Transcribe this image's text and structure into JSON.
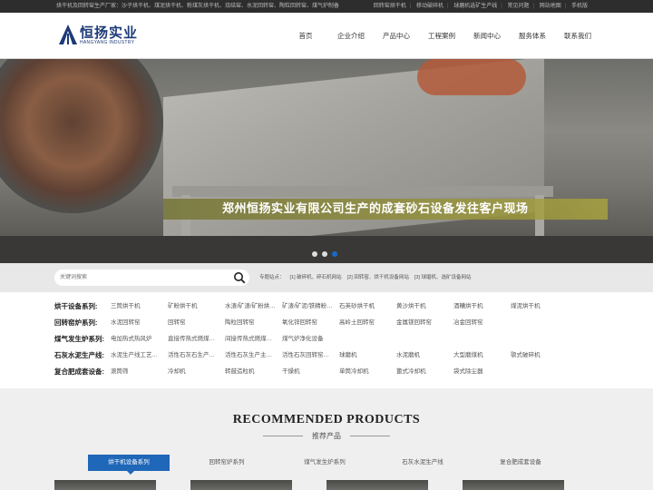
{
  "topbar": {
    "intro": "烘干机及回转窑生产厂家：沙子烘干机、煤泥烘干机、粉煤灰烘干机、烧结窑、水泥回转窑、陶粒回转窑、煤气炉制备",
    "links": [
      "回转窑烘干机",
      "移动破碎机",
      "球磨机选矿生产线",
      "常见问题",
      "网站地图",
      "手机版"
    ]
  },
  "logo": {
    "cn": "恒扬实业",
    "en": "HANGYANG INDUSTRY",
    "color": "#1d3a78"
  },
  "nav": [
    "首页",
    "企业介绍",
    "产品中心",
    "工程案例",
    "新闻中心",
    "服务体系",
    "联系我们"
  ],
  "banner": {
    "caption": "郑州恒扬实业有限公司生产的成套砂石设备发往客户现场",
    "active_dot": 3
  },
  "search": {
    "placeholder": "关键词搜索",
    "hot_label": "专题站点：",
    "hot_links": [
      "[1] 破碎机、碎石机网站",
      "[2] 回转窑、烘干机设备网站",
      "[3] 球磨机、选矿设备网站"
    ]
  },
  "categories": [
    {
      "title": "烘干设备系列:",
      "items": [
        "三筒烘干机",
        "矿粉烘干机",
        "水渣/矿渣/矿粉烘…",
        "矿渣/矿泥/铁精粉…",
        "石英砂烘干机",
        "黄沙烘干机",
        "酒糟烘干机",
        "煤泥烘干机"
      ]
    },
    {
      "title": "回转窑炉系列:",
      "items": [
        "水泥回转窑",
        "回转窑",
        "陶粒回转窑",
        "氧化锌回转窑",
        "高岭土回转窑",
        "金属镁回转窑",
        "冶金回转窑"
      ]
    },
    {
      "title": "煤气发生炉系列:",
      "items": [
        "电加热式热风炉",
        "直接传热式燃煤…",
        "间接传热式燃煤…",
        "煤气炉净化设备"
      ]
    },
    {
      "title": "石灰水泥生产线:",
      "items": [
        "水泥生产线工艺…",
        "活性石灰石生产…",
        "活性石灰生产主…",
        "活性石灰回转窑…",
        "球磨机",
        "水泥磨机",
        "大型磨煤机",
        "颚式破碎机"
      ]
    },
    {
      "title": "复合肥成套设备:",
      "items": [
        "滚筒筛",
        "冷却机",
        "转鼓造粒机",
        "干燥机",
        "单筒冷却机",
        "篦式冷却机",
        "袋式除尘器"
      ]
    }
  ],
  "recommended": {
    "title": "RECOMMENDED PRODUCTS",
    "subtitle": "推荐产品",
    "tabs": [
      "烘干机设备系列",
      "回转窑炉系列",
      "煤气发生炉系列",
      "石灰水泥生产线",
      "复合肥成套设备"
    ],
    "active_tab": 0,
    "accent": "#1f67b8"
  }
}
